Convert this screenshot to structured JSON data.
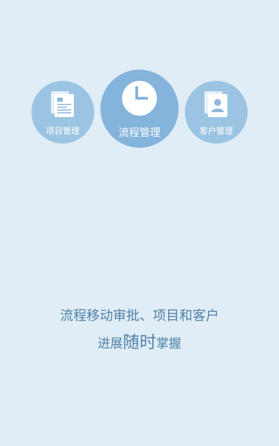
{
  "features": [
    {
      "id": "project",
      "label": "项目管理",
      "icon": "document-icon"
    },
    {
      "id": "process",
      "label": "流程管理",
      "icon": "clock-icon"
    },
    {
      "id": "customer",
      "label": "客户管理",
      "icon": "contact-card-icon"
    }
  ],
  "tagline": {
    "line1": "流程移动审批、项目和客户",
    "line2_before": "进展",
    "line2_emphasis": "随时",
    "line2_after": "掌握"
  },
  "colors": {
    "background": "#e0edf6",
    "circle_small": "#9bc4e2",
    "circle_large": "#84b3dc",
    "tagline_text": "#4f82a8",
    "icon_white": "#ffffff"
  }
}
